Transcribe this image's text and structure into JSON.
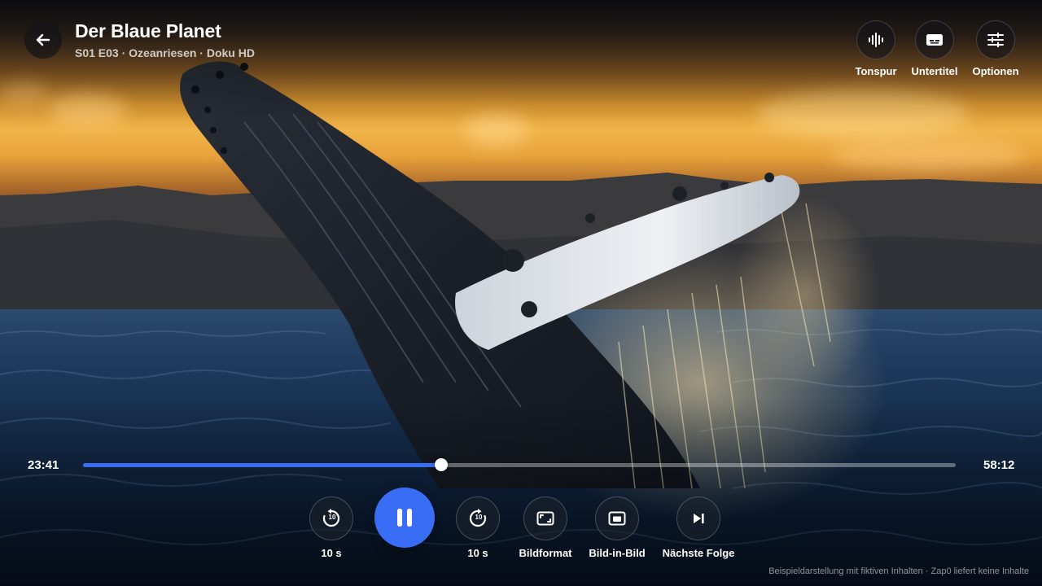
{
  "player": {
    "title": "Der Blaue Planet",
    "subtitle": "S01 E03 · Ozeanriesen · Doku HD",
    "accent": "#3a6df5"
  },
  "top_actions": [
    {
      "label": "Tonspur",
      "icon": "audio-wave-icon"
    },
    {
      "label": "Untertitel",
      "icon": "subtitles-icon"
    },
    {
      "label": "Optionen",
      "icon": "sliders-icon"
    }
  ],
  "timeline": {
    "elapsed": "23:41",
    "total": "58:12",
    "progress": 0.41
  },
  "controls": {
    "rewind_label": "10 s",
    "rewind_icon_num": "10",
    "forward_label": "10 s",
    "forward_icon_num": "10",
    "aspect_label": "Bildformat",
    "pip_label": "Bild-in-Bild",
    "next_label": "Nächste Folge"
  },
  "footer": {
    "disclaimer": "Beispieldarstellung mit fiktiven Inhalten · Zap0 liefert keine Inhalte"
  }
}
